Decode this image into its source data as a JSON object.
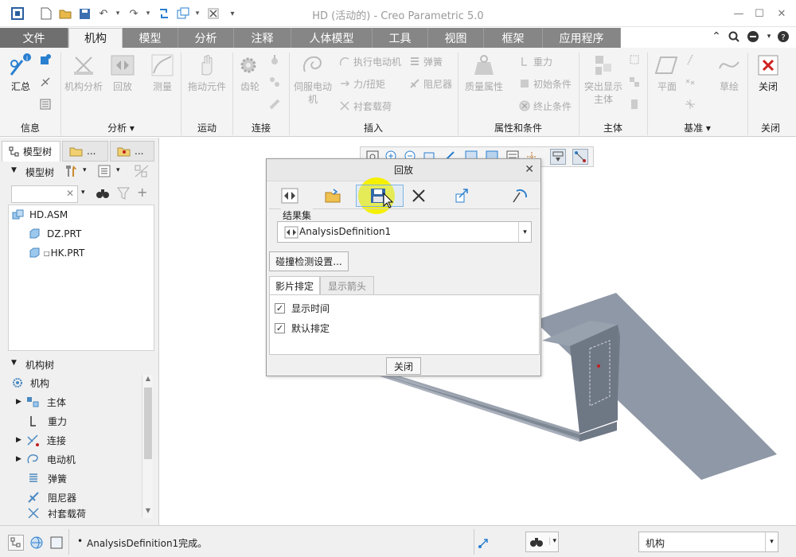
{
  "app": {
    "title": "HD (活动的) - Creo Parametric 5.0"
  },
  "tabs": [
    "文件",
    "机构",
    "模型",
    "分析",
    "注释",
    "人体模型",
    "工具",
    "视图",
    "框架",
    "应用程序"
  ],
  "ribbon": {
    "info": {
      "summary": "汇总",
      "group": "信息"
    },
    "analysis": {
      "mech_analysis": "机构分析",
      "playback": "回放",
      "measure": "测量",
      "group": "分析 ▾"
    },
    "motion": {
      "drag": "拖动元件",
      "group": "运动"
    },
    "connection": {
      "gear": "齿轮",
      "group": "连接"
    },
    "insert": {
      "servo": "伺服电动机",
      "exec_motor": "执行电动机",
      "force": "力/扭矩",
      "bushing": "衬套载荷",
      "spring": "弹簧",
      "damper": "阻尼器",
      "group": "插入"
    },
    "props": {
      "mass": "质量属性",
      "gravity": "重力",
      "init_cond": "初始条件",
      "term_cond": "终止条件",
      "group": "属性和条件"
    },
    "body": {
      "highlight": "突出显示主体",
      "group": "主体"
    },
    "datum": {
      "plane": "平面",
      "sketch": "草绘",
      "group": "基准 ▾"
    },
    "close": {
      "close": "关闭",
      "group": "关闭"
    }
  },
  "left_panel": {
    "tabs": [
      "模型树",
      "...",
      "..."
    ],
    "model_tree_label": "模型树",
    "search_placeholder": "",
    "model_items": [
      "HD.ASM",
      "DZ.PRT",
      "HK.PRT"
    ],
    "mech_tree_label": "机构树",
    "mech_items": [
      "机构",
      "主体",
      "重力",
      "连接",
      "电动机",
      "弹簧",
      "阻尼器",
      "衬套载荷"
    ]
  },
  "dialog": {
    "title": "回放",
    "result_set_label": "结果集",
    "result_set_value": "AnalysisDefinition1",
    "collision_button": "碰撞检测设置...",
    "subtabs": [
      "影片排定",
      "显示箭头"
    ],
    "checks": [
      {
        "label": "显示时间",
        "checked": true
      },
      {
        "label": "默认排定",
        "checked": true
      }
    ],
    "close_button": "关闭"
  },
  "status": {
    "message": "AnalysisDefinition1完成。",
    "filter_value": "机构"
  },
  "colors": {
    "accent_blue": "#2a7fcf",
    "highlight_yellow": "#f5f000",
    "tab_gray": "#868686",
    "model_gray": "#8e97a5"
  }
}
